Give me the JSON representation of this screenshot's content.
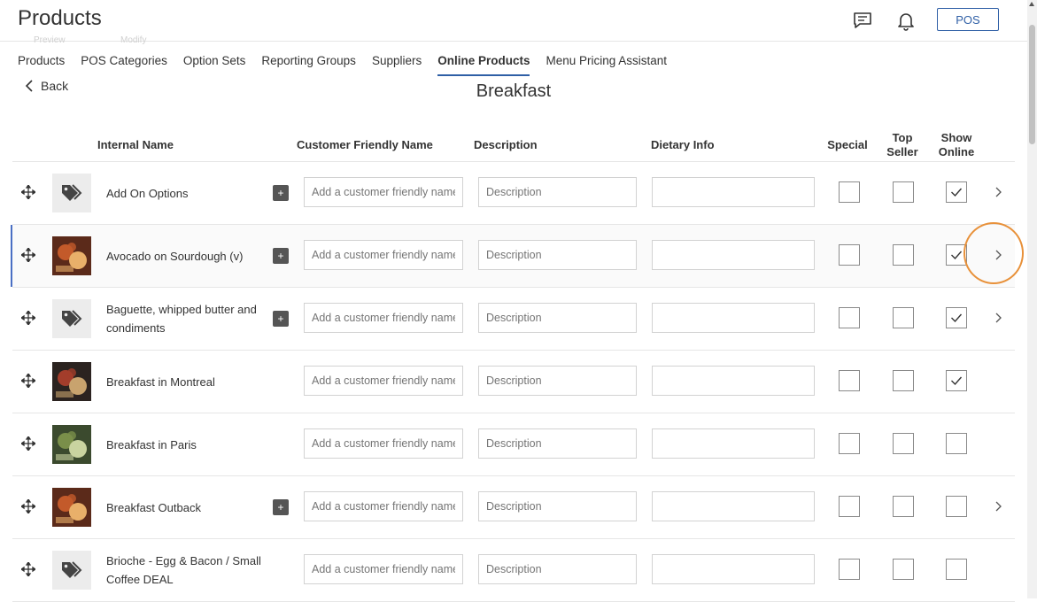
{
  "header": {
    "title": "Products",
    "pos_label": "POS",
    "icons": [
      "message-icon",
      "bell-icon"
    ],
    "ghost_labels": [
      "Preview",
      "Modify"
    ]
  },
  "tabs": [
    {
      "label": "Products",
      "active": false
    },
    {
      "label": "POS Categories",
      "active": false
    },
    {
      "label": "Option Sets",
      "active": false
    },
    {
      "label": "Reporting Groups",
      "active": false
    },
    {
      "label": "Suppliers",
      "active": false
    },
    {
      "label": "Online Products",
      "active": true
    },
    {
      "label": "Menu Pricing Assistant",
      "active": false
    }
  ],
  "back_label": "Back",
  "section_title": "Breakfast",
  "columns": {
    "internal_name": "Internal Name",
    "customer_friendly_name": "Customer Friendly Name",
    "description": "Description",
    "dietary_info": "Dietary Info",
    "special": "Special",
    "top_seller": "Top Seller",
    "show_online": "Show Online"
  },
  "placeholders": {
    "customer_friendly_name": "Add a customer friendly name",
    "description": "Description",
    "dietary_info": ""
  },
  "rows": [
    {
      "name": "Add On Options",
      "image": "tag",
      "has_options": true,
      "special": false,
      "top_seller": false,
      "show_online": true,
      "chevron": true,
      "selected": false
    },
    {
      "name": "Avocado on Sourdough (v)",
      "image": "photo",
      "has_options": true,
      "special": false,
      "top_seller": false,
      "show_online": true,
      "chevron": true,
      "selected": true
    },
    {
      "name": "Baguette, whipped butter and condiments",
      "image": "tag",
      "has_options": true,
      "special": false,
      "top_seller": false,
      "show_online": true,
      "chevron": true,
      "selected": false
    },
    {
      "name": "Breakfast in Montreal",
      "image": "photo",
      "has_options": false,
      "special": false,
      "top_seller": false,
      "show_online": true,
      "chevron": false,
      "selected": false
    },
    {
      "name": "Breakfast in Paris",
      "image": "photo",
      "has_options": false,
      "special": false,
      "top_seller": false,
      "show_online": false,
      "chevron": false,
      "selected": false
    },
    {
      "name": "Breakfast Outback",
      "image": "photo",
      "has_options": true,
      "special": false,
      "top_seller": false,
      "show_online": false,
      "chevron": true,
      "selected": false
    },
    {
      "name": "Brioche - Egg & Bacon / Small Coffee DEAL",
      "image": "tag",
      "has_options": false,
      "special": false,
      "top_seller": false,
      "show_online": false,
      "chevron": false,
      "selected": false
    }
  ],
  "colors": {
    "accent": "#2f5fa6",
    "highlight_ring": "#e8913a",
    "selected_bar": "#4a6fc4"
  }
}
